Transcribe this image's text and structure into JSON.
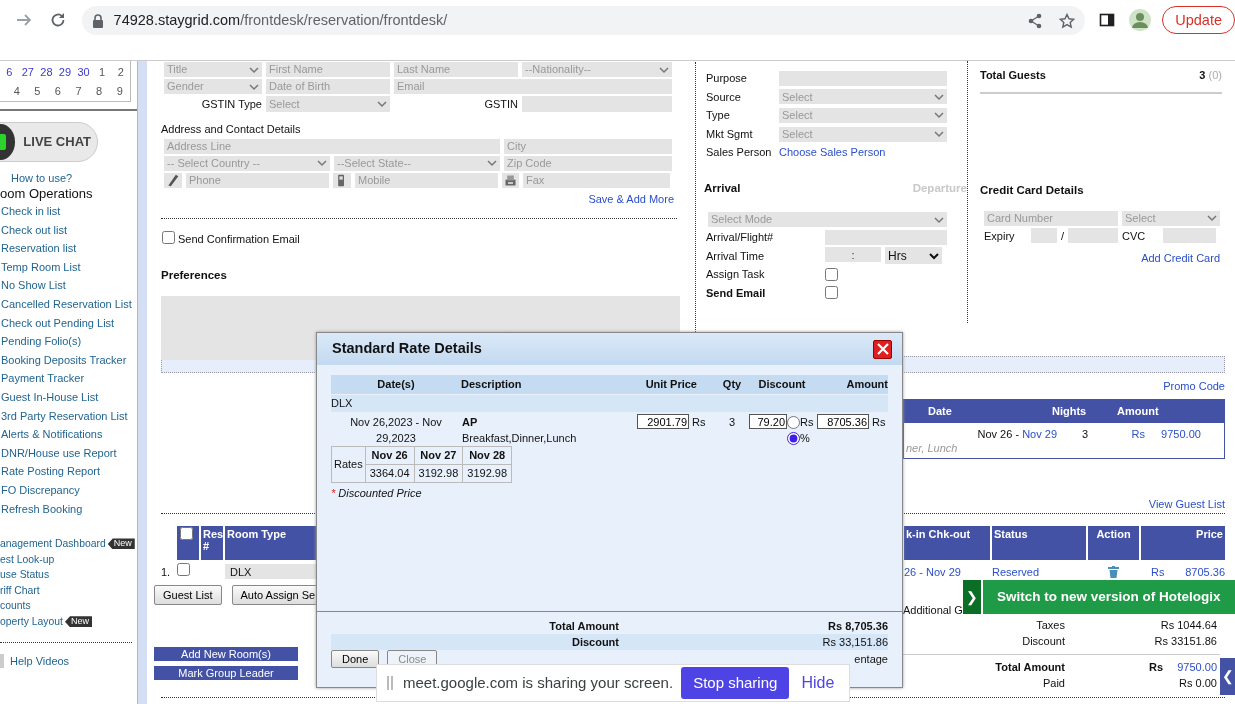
{
  "browser": {
    "url_host": "74928.staygrid.com",
    "url_path": "/frontdesk/reservation/frontdesk/",
    "update_button": "Update"
  },
  "sidebar": {
    "calendar": [
      [
        {
          "day": "6",
          "muted": false
        },
        {
          "day": "27",
          "muted": false
        },
        {
          "day": "28",
          "muted": false
        },
        {
          "day": "29",
          "muted": false
        },
        {
          "day": "30",
          "muted": false
        },
        {
          "day": "1",
          "muted": true
        },
        {
          "day": "2",
          "muted": true
        }
      ],
      [
        {
          "day": "4",
          "muted": true
        },
        {
          "day": "5",
          "muted": true
        },
        {
          "day": "6",
          "muted": true
        },
        {
          "day": "7",
          "muted": true
        },
        {
          "day": "8",
          "muted": true
        },
        {
          "day": "9",
          "muted": true
        }
      ]
    ],
    "chat_button": "LIVE CHAT",
    "how_to_use": "How to use?",
    "section_title": "oom Operations",
    "links": [
      "Check in list",
      "Check out list",
      "Reservation list",
      "Temp Room List",
      "No Show List",
      "Cancelled Reservation List",
      "Check out Pending List",
      "Pending Folio(s)",
      "Booking Deposits Tracker",
      "Payment Tracker",
      "Guest In-House List",
      "3rd Party Reservation List",
      "Alerts & Notifications",
      "DNR/House use Report",
      "Rate Posting Report",
      "FO Discrepancy",
      "Refresh Booking"
    ],
    "more_links": [
      {
        "label": "anagement Dashboard",
        "badge": "New"
      },
      {
        "label": "est Look-up"
      },
      {
        "label": "use Status"
      },
      {
        "label": "riff Chart"
      },
      {
        "label": "counts"
      },
      {
        "label": "operty Layout",
        "badge": "New"
      }
    ],
    "help_videos": "Help Videos"
  },
  "guest": {
    "rows": [
      [
        {
          "kind": "select",
          "placeholder": "Title"
        },
        {
          "kind": "input",
          "placeholder": "First Name"
        },
        {
          "kind": "input",
          "placeholder": "Last Name"
        },
        {
          "kind": "select",
          "placeholder": "--Nationality--"
        }
      ],
      [
        {
          "kind": "select",
          "placeholder": "Gender"
        },
        {
          "kind": "input",
          "placeholder": "Date of Birth"
        },
        {
          "kind": "input",
          "placeholder": "Email"
        }
      ],
      [
        {
          "kind": "label",
          "text": "GSTIN Type"
        },
        {
          "kind": "select",
          "placeholder": "Select"
        },
        {
          "kind": "label",
          "text": "GSTIN"
        },
        {
          "kind": "input"
        }
      ]
    ],
    "address_title": "Address and Contact Details",
    "address_rows": [
      [
        {
          "kind": "input",
          "placeholder": "Address Line"
        },
        {
          "kind": "input",
          "placeholder": "City"
        }
      ],
      [
        {
          "kind": "select",
          "placeholder": "-- Select Country --"
        },
        {
          "kind": "select",
          "placeholder": "--Select State--"
        },
        {
          "kind": "input",
          "placeholder": "Zip Code"
        }
      ],
      [
        {
          "kind": "icon"
        },
        {
          "kind": "input",
          "placeholder": "Phone"
        },
        {
          "kind": "icon"
        },
        {
          "kind": "input",
          "placeholder": "Mobile"
        },
        {
          "kind": "icon"
        },
        {
          "kind": "input",
          "placeholder": "Fax"
        }
      ]
    ],
    "save_link": "Save & Add More",
    "send_confirmation": {
      "label": "Send Confirmation Email",
      "checked": false
    },
    "preferences_title": "Preferences"
  },
  "booking": {
    "rows": [
      {
        "label": "Purpose",
        "kind": "input"
      },
      {
        "label": "Source",
        "kind": "select",
        "placeholder": "Select"
      },
      {
        "label": "Type",
        "kind": "select",
        "placeholder": "Select"
      },
      {
        "label": "Mkt Sgmt",
        "kind": "select",
        "placeholder": "Select"
      },
      {
        "label": "Sales Person",
        "kind": "link",
        "text": "Choose Sales Person"
      }
    ],
    "tabs": [
      {
        "label": "Arrival",
        "selected": true
      },
      {
        "label": "Departure",
        "selected": false
      }
    ],
    "mode_select": "Select Mode",
    "arrival_rows": [
      {
        "label": "Arrival/Flight#",
        "kind": "input"
      },
      {
        "label": "Arrival Time",
        "kind": "time",
        "value": ":",
        "unit": "Hrs"
      },
      {
        "label": "Assign Task",
        "kind": "checkbox",
        "checked": false
      },
      {
        "label": "Send Email",
        "kind": "checkbox",
        "checked": false,
        "bold": true
      }
    ]
  },
  "guests_total": {
    "label": "Total Guests",
    "count": "3",
    "extra": "(0)"
  },
  "credit_card": {
    "title": "Credit Card Details",
    "number_placeholder": "Card Number",
    "type_placeholder": "Select",
    "expiry_label": "Expiry",
    "separator": "/",
    "cvc_label": "CVC",
    "add_link": "Add Credit Card"
  },
  "promo_link": "Promo Code",
  "rate_table": {
    "columns": [
      "Date",
      "Nights",
      "Amount"
    ],
    "row": {
      "date_from": "Nov 26 -",
      "date_to": "Nov 29",
      "nights": "3",
      "currency": "Rs",
      "amount": "9750.00",
      "note": "ner, Lunch"
    }
  },
  "view_guest_list": "View Guest List",
  "rooms": {
    "columns": [
      "Res #",
      "Room Type",
      "k-in Chk-out",
      "Status",
      "Action",
      "Price"
    ],
    "header_checked": false,
    "rows": [
      {
        "number": "1.",
        "checked": false,
        "room_type": "DLX",
        "dates": "26 - Nov 29",
        "status": "Reserved",
        "currency": "Rs",
        "price": "8705.36"
      }
    ],
    "buttons": [
      "Guest List",
      "Auto Assign Se"
    ],
    "additional": "Additional G"
  },
  "totals": [
    {
      "kind": "plain",
      "label": "Taxes",
      "value": "Rs 1044.64"
    },
    {
      "kind": "plain",
      "label": "Discount",
      "value": "Rs 33151.86"
    },
    {
      "kind": "grand",
      "label": "Total Amount",
      "currency": "Rs",
      "value": "9750.00"
    },
    {
      "kind": "plain",
      "label": "Paid",
      "value": "Rs 0.00"
    }
  ],
  "group_buttons": [
    "Add New Room(s)",
    "Mark Group Leader"
  ],
  "modal": {
    "title": "Standard Rate Details",
    "columns": [
      "Date(s)",
      "Description",
      "Unit Price",
      "Qty",
      "Discount",
      "Amount"
    ],
    "group": "DLX",
    "line": {
      "dates": "Nov 26,2023 - Nov 29,2023",
      "plan": "AP",
      "meals": "Breakfast,Dinner,Lunch",
      "unit_price": "2901.79",
      "unit_currency": "Rs",
      "qty": "3",
      "discount": "79.20",
      "discount_modes": [
        {
          "label": "Rs",
          "selected": false
        },
        {
          "label": "%",
          "selected": true
        }
      ],
      "amount": "8705.36",
      "amount_currency": "Rs"
    },
    "rates_label": "Rates",
    "rates": [
      {
        "date": "Nov 26",
        "rate": "3364.04"
      },
      {
        "date": "Nov 27",
        "rate": "3192.98"
      },
      {
        "date": "Nov 28",
        "rate": "3192.98"
      }
    ],
    "note_mark": "*",
    "note": "Discounted Price",
    "summary": [
      {
        "label": "Total Amount",
        "value": "Rs 8,705.36",
        "bold": true
      },
      {
        "label": "Discount",
        "value": "Rs 33,151.86",
        "bold": false
      }
    ],
    "buttons": [
      {
        "label": "Done",
        "disabled": false
      },
      {
        "label": "Close",
        "disabled": true
      }
    ],
    "footnote": "entage"
  },
  "banner": {
    "arrow": "❯",
    "text": "Switch to new version of Hotelogix"
  },
  "side_tab": {
    "arrow": "❮"
  },
  "share_bar": {
    "message": "meet.google.com is sharing your screen.",
    "stop_button": "Stop sharing",
    "hide_link": "Hide"
  }
}
